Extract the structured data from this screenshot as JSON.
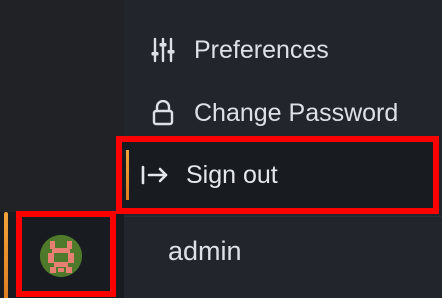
{
  "menu": {
    "items": [
      {
        "label": "Preferences",
        "icon": "sliders-icon"
      },
      {
        "label": "Change Password",
        "icon": "lock-icon"
      },
      {
        "label": "Sign out",
        "icon": "sign-out-arrow-icon"
      }
    ],
    "username": "admin"
  },
  "colors": {
    "sidebar_bg": "#181b1f",
    "menu_bg": "#22252b",
    "text": "#dde1e7",
    "accent": "#f2a33a",
    "highlight_box": "#ff0000"
  }
}
